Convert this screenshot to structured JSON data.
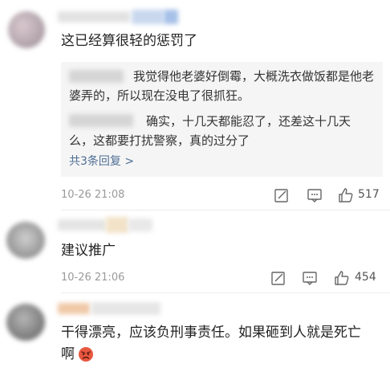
{
  "comments": [
    {
      "text": "这已经算很轻的惩罚了",
      "replies": [
        {
          "text": "我觉得他老婆好倒霉，大概洗衣做饭都是他老婆弄的，所以现在没电了很抓狂。"
        },
        {
          "text": "确实，十几天都能忍了，还差这十几天么，这都要打扰警察，真的过分了"
        }
      ],
      "more_replies": "共3条回复 >",
      "time": "10-26 21:08",
      "like_count": "517"
    },
    {
      "text": "建议推广",
      "time": "10-26 21:06",
      "like_count": "454"
    },
    {
      "text_line1": "干得漂亮，应该负刑事责任。如果砸到人就是死亡",
      "text_line2": "啊",
      "emoji": "angry-face"
    }
  ],
  "colors": {
    "reply_bg": "#f5f5f5",
    "link": "#4e6e95",
    "meta": "#9a9a9a"
  }
}
